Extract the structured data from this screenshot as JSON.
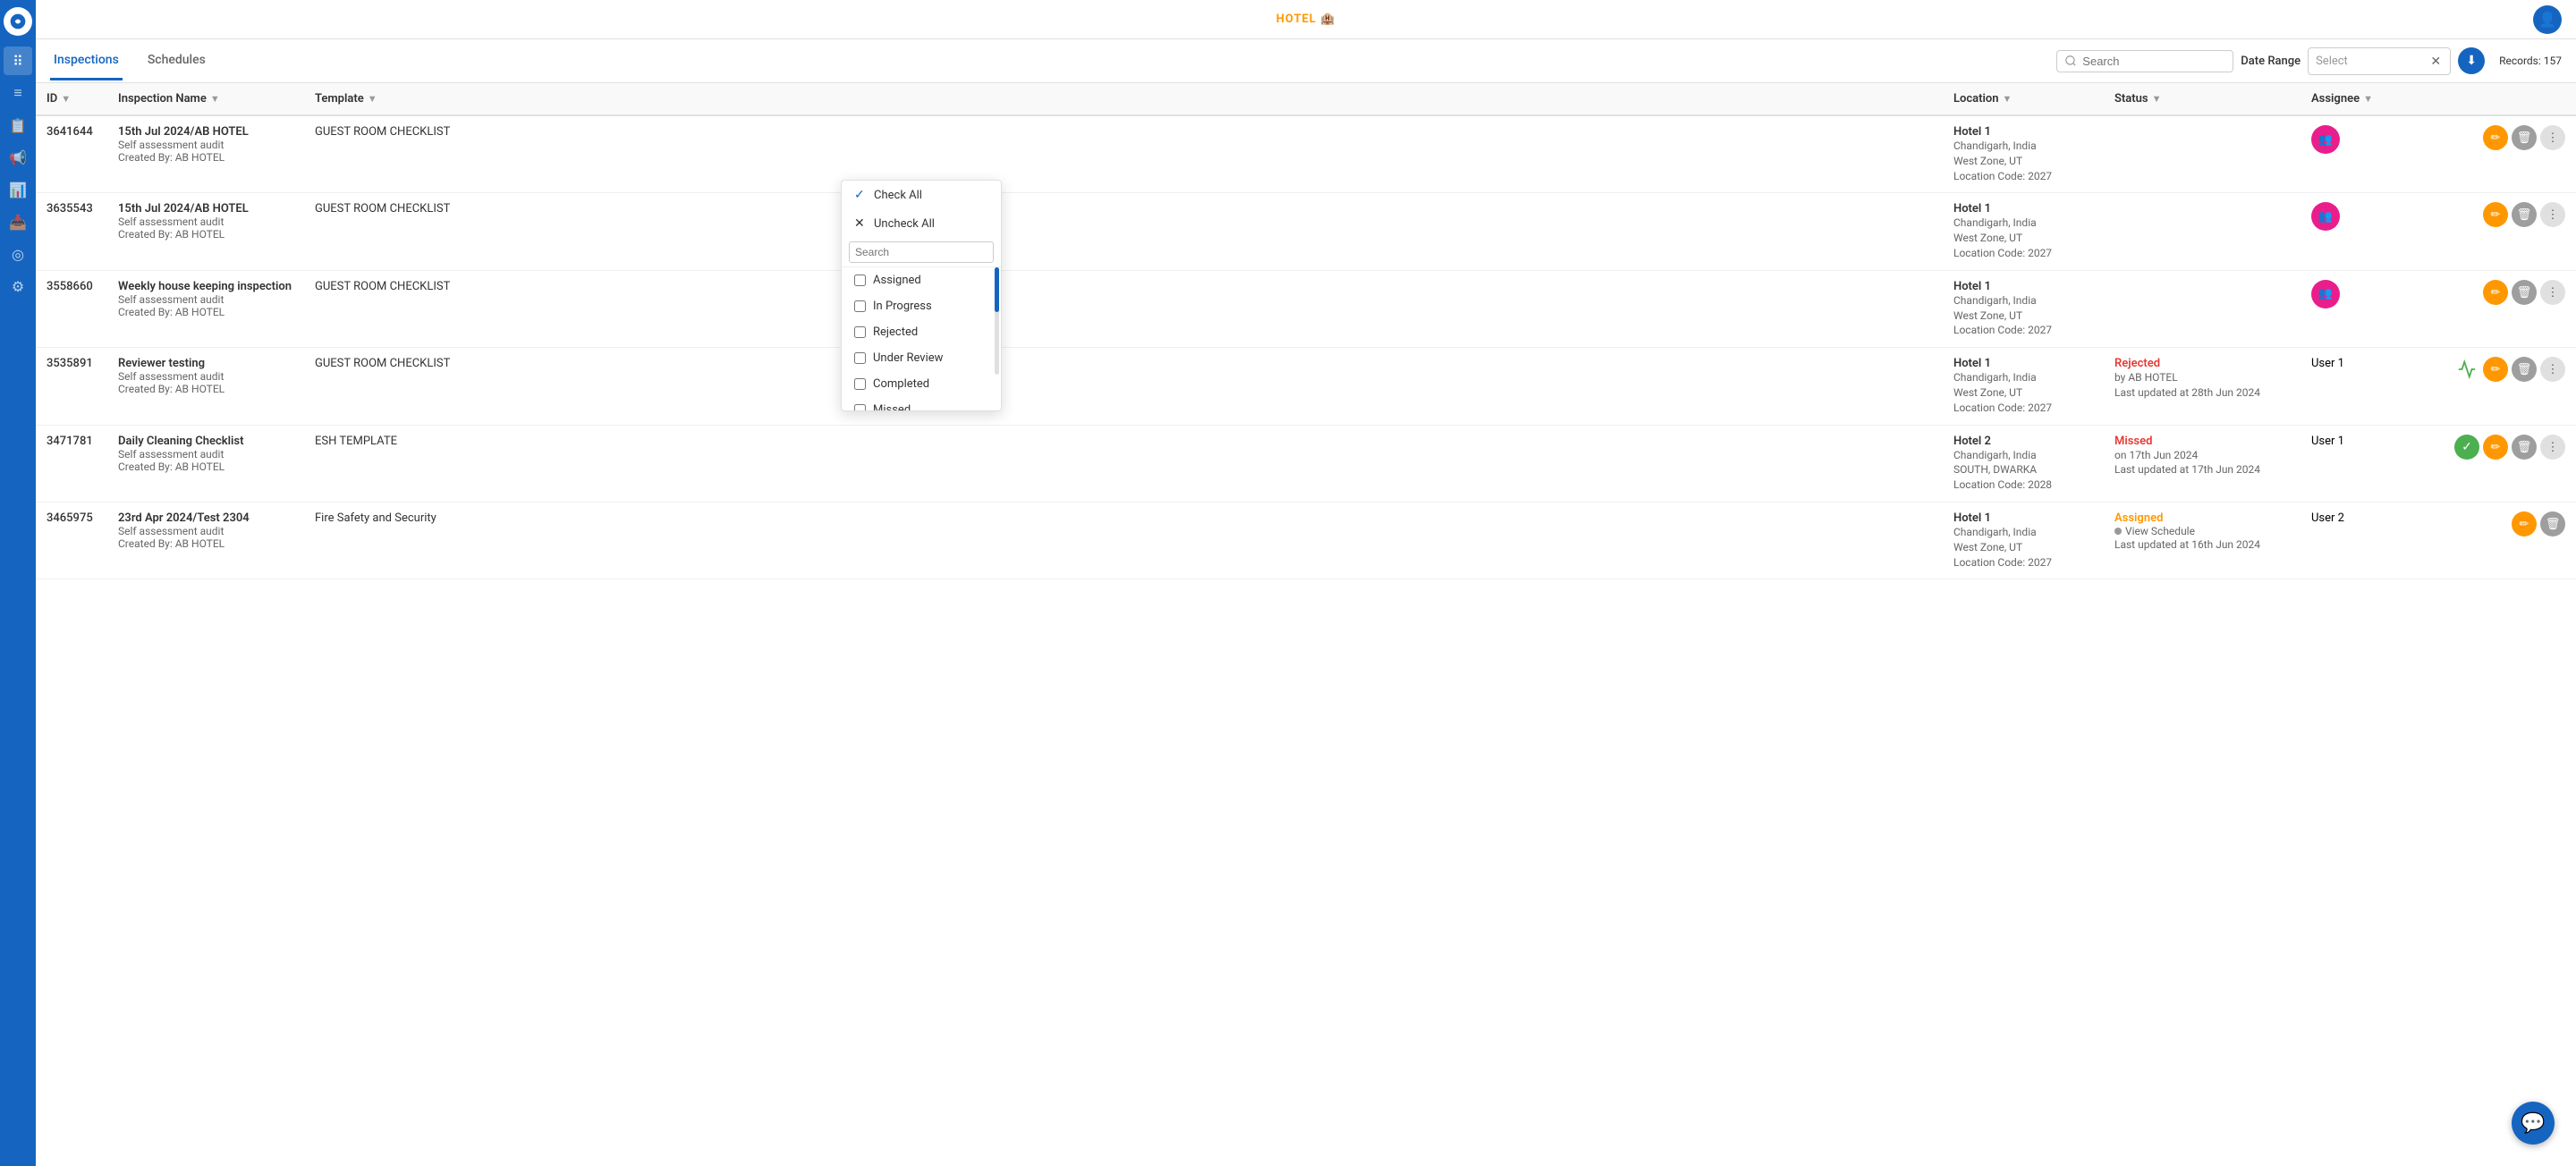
{
  "brand": "HOTEL 🏨",
  "tabs": [
    {
      "label": "Inspections",
      "active": true
    },
    {
      "label": "Schedules",
      "active": false
    }
  ],
  "toolbar": {
    "search_placeholder": "Search",
    "date_range_label": "Date Range",
    "date_range_placeholder": "Select",
    "records_label": "Records: 157"
  },
  "table": {
    "columns": [
      "ID",
      "Inspection Name",
      "Template",
      "Location",
      "Status",
      "Assignee"
    ],
    "rows": [
      {
        "id": "3641644",
        "name": "15th Jul 2024/AB HOTEL",
        "sub1": "Self assessment audit",
        "sub2": "Created By: AB HOTEL",
        "template": "GUEST ROOM CHECKLIST",
        "location_name": "Hotel 1",
        "location_city": "Chandigarh, India",
        "location_zone": "West Zone, UT",
        "location_code": "Location Code: 2027",
        "status": "",
        "assignee_icon": "group-icon",
        "has_avatar": true
      },
      {
        "id": "3635543",
        "name": "15th Jul 2024/AB HOTEL",
        "sub1": "Self assessment audit",
        "sub2": "Created By: AB HOTEL",
        "template": "GUEST ROOM CHECKLIST",
        "location_name": "Hotel 1",
        "location_city": "Chandigarh, India",
        "location_zone": "West Zone, UT",
        "location_code": "Location Code: 2027",
        "status": "",
        "assignee_icon": "group-icon",
        "has_avatar": true
      },
      {
        "id": "3558660",
        "name": "Weekly house keeping inspection",
        "sub1": "Self assessment audit",
        "sub2": "Created By: AB HOTEL",
        "template": "GUEST ROOM CHECKLIST",
        "location_name": "Hotel 1",
        "location_city": "Chandigarh, India",
        "location_zone": "West Zone, UT",
        "location_code": "Location Code: 2027",
        "status": "",
        "assignee_icon": "group-icon",
        "has_avatar": true
      },
      {
        "id": "3535891",
        "name": "Reviewer testing",
        "sub1": "Self assessment audit",
        "sub2": "Created By: AB HOTEL",
        "template": "GUEST ROOM CHECKLIST",
        "location_name": "Hotel 1",
        "location_city": "Chandigarh, India",
        "location_zone": "West Zone, UT",
        "location_code": "Location Code: 2027",
        "status": "Rejected",
        "status_type": "rejected",
        "status_by": "by AB HOTEL",
        "status_updated": "Last updated at 28th Jun 2024",
        "assignee": "User 1",
        "has_analytics": true
      },
      {
        "id": "3471781",
        "name": "Daily Cleaning Checklist",
        "sub1": "Self assessment audit",
        "sub2": "Created By: AB HOTEL",
        "template": "ESH TEMPLATE",
        "location_name": "Hotel 2",
        "location_city": "Chandigarh, India",
        "location_zone": "SOUTH, DWARKA",
        "location_code": "Location Code: 2028",
        "status": "Missed",
        "status_type": "missed",
        "status_on": "on 17th Jun 2024",
        "status_updated": "Last updated at 17th Jun 2024",
        "assignee": "User 1",
        "has_checkin": true
      },
      {
        "id": "3465975",
        "name": "23rd Apr 2024/Test 2304",
        "sub1": "Self assessment audit",
        "sub2": "Created By: AB HOTEL",
        "template": "Fire Safety and Security",
        "location_name": "Hotel 1",
        "location_city": "Chandigarh, India",
        "location_zone": "West Zone, UT",
        "location_code": "Location Code: 2027",
        "status": "Assigned",
        "status_type": "assigned",
        "view_schedule": "View Schedule",
        "status_updated": "Last updated at 16th Jun 2024",
        "assignee": "User 2"
      }
    ]
  },
  "status_dropdown": {
    "check_all": "Check All",
    "uncheck_all": "Uncheck All",
    "search_placeholder": "Search",
    "options": [
      {
        "label": "Assigned",
        "checked": false
      },
      {
        "label": "In Progress",
        "checked": false
      },
      {
        "label": "Rejected",
        "checked": false
      },
      {
        "label": "Under Review",
        "checked": false
      },
      {
        "label": "Completed",
        "checked": false
      },
      {
        "label": "Missed",
        "checked": false
      }
    ]
  },
  "sidebar_icons": [
    {
      "name": "logo-icon",
      "symbol": "☁"
    },
    {
      "name": "grid-icon",
      "symbol": "⠿"
    },
    {
      "name": "list-icon",
      "symbol": "☰"
    },
    {
      "name": "document-icon",
      "symbol": "📄"
    },
    {
      "name": "flag-icon",
      "symbol": "⚑"
    },
    {
      "name": "chart-icon",
      "symbol": "📊"
    },
    {
      "name": "bell-icon",
      "symbol": "🔔"
    },
    {
      "name": "location-icon",
      "symbol": "📍"
    },
    {
      "name": "gear-icon",
      "symbol": "⚙"
    }
  ]
}
